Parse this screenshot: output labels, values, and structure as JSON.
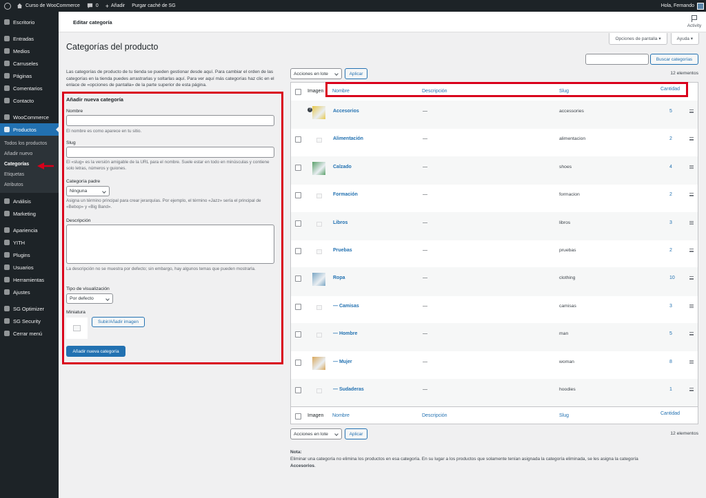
{
  "admin_bar": {
    "site_name": "Curso de WooCommerce",
    "comments_count": "0",
    "new_label": "Añadir",
    "purge_label": "Purgar caché de SG",
    "greeting": "Hola, Fernando"
  },
  "sidebar": {
    "items": [
      {
        "label": "Escritorio",
        "icon": "dashboard-icon"
      },
      {
        "label": "Entradas",
        "icon": "pin-icon"
      },
      {
        "label": "Medios",
        "icon": "media-icon"
      },
      {
        "label": "Carruseles",
        "icon": "carousel-icon"
      },
      {
        "label": "Páginas",
        "icon": "page-icon"
      },
      {
        "label": "Comentarios",
        "icon": "comment-icon"
      },
      {
        "label": "Contacto",
        "icon": "mail-icon"
      },
      {
        "label": "WooCommerce",
        "icon": "woo-icon"
      },
      {
        "label": "Productos",
        "icon": "product-icon"
      }
    ],
    "submenu": [
      "Todos los productos",
      "Añadir nuevo",
      "Categorías",
      "Etiquetas",
      "Atributos"
    ],
    "items_after": [
      {
        "label": "Análisis",
        "icon": "chart-icon"
      },
      {
        "label": "Marketing",
        "icon": "megaphone-icon"
      },
      {
        "label": "Apariencia",
        "icon": "brush-icon"
      },
      {
        "label": "YITH",
        "icon": "yith-icon"
      },
      {
        "label": "Plugins",
        "icon": "plugin-icon"
      },
      {
        "label": "Usuarios",
        "icon": "user-icon"
      },
      {
        "label": "Herramientas",
        "icon": "wrench-icon"
      },
      {
        "label": "Ajustes",
        "icon": "settings-icon"
      },
      {
        "label": "SG Optimizer",
        "icon": "sg-optimizer-icon"
      },
      {
        "label": "SG Security",
        "icon": "shield-icon"
      },
      {
        "label": "Cerrar menú",
        "icon": "collapse-icon"
      }
    ]
  },
  "header": {
    "page_label": "Editar categoría",
    "activity": "Activity",
    "screen_options": "Opciones de pantalla ▾",
    "help": "Ayuda ▾"
  },
  "title": "Categorías del producto",
  "intro": "Las categorías de producto de tu tienda se pueden gestionar desde aquí. Para cambiar el orden de las categorías en la tienda puedes arrastrarlas y soltarlas aquí. Para ver aquí más categorías haz clic en el enlace de «opciones de pantalla» de la parte superior de esta página.",
  "form": {
    "heading": "Añadir nueva categoría",
    "name_label": "Nombre",
    "name_help": "El nombre es como aparece en tu sitio.",
    "slug_label": "Slug",
    "slug_help": "El «slug» es la versión amigable de la URL para el nombre. Suele estar en todo en minúsculas y contiene solo letras, números y guiones.",
    "parent_label": "Categoría padre",
    "parent_value": "Ninguna",
    "parent_help": "Asigna un término principal para crear jerarquías. Por ejemplo, el término «Jazz» sería el principal de «Bebop» y «Big Band».",
    "desc_label": "Descripción",
    "desc_help": "La descripción no se muestra por defecto; sin embargo, hay algunos temas que pueden mostrarla.",
    "display_label": "Tipo de visualización",
    "display_value": "Por defecto",
    "thumb_label": "Miniatura",
    "upload_button": "Subir/Añadir imagen",
    "submit_button": "Añadir nueva categoría"
  },
  "search_button": "Buscar categorías",
  "bulk": {
    "label": "Acciones en lote",
    "apply": "Aplicar"
  },
  "items_count": "12 elementos",
  "columns": {
    "image": "Imagen",
    "name": "Nombre",
    "description": "Descripción",
    "slug": "Slug",
    "count": "Cantidad"
  },
  "rows": [
    {
      "name": "Accesorios",
      "desc": "—",
      "slug": "accessories",
      "count": "5",
      "img": "accessories-thumb",
      "color": "#e8c84a"
    },
    {
      "name": "Alimentación",
      "desc": "—",
      "slug": "alimentacion",
      "count": "2",
      "img": "placeholder"
    },
    {
      "name": "Calzado",
      "desc": "—",
      "slug": "shoes",
      "count": "4",
      "img": "shoes-thumb",
      "color": "#5aa06a"
    },
    {
      "name": "Formación",
      "desc": "—",
      "slug": "formacion",
      "count": "2",
      "img": "placeholder"
    },
    {
      "name": "Libros",
      "desc": "—",
      "slug": "libros",
      "count": "3",
      "img": "placeholder"
    },
    {
      "name": "Pruebas",
      "desc": "—",
      "slug": "pruebas",
      "count": "2",
      "img": "placeholder"
    },
    {
      "name": "Ropa",
      "desc": "—",
      "slug": "clothing",
      "count": "10",
      "img": "clothing-thumb",
      "color": "#7aa6c4"
    },
    {
      "name": "— Camisas",
      "desc": "—",
      "slug": "camisas",
      "count": "3",
      "img": "placeholder"
    },
    {
      "name": "— Hombre",
      "desc": "—",
      "slug": "man",
      "count": "5",
      "img": "placeholder"
    },
    {
      "name": "— Mujer",
      "desc": "—",
      "slug": "woman",
      "count": "8",
      "img": "woman-thumb",
      "color": "#d9a85c"
    },
    {
      "name": "— Sudaderas",
      "desc": "—",
      "slug": "hoodies",
      "count": "1",
      "img": "placeholder"
    }
  ],
  "note_title": "Nota:",
  "note_text": "Eliminar una categoría no elimina los productos en esa categoría. En su lugar a los productos que solamente tenían asignada la categoría eliminada, se les asigna la categoría",
  "note_cat": "Accesorios",
  "colors": {
    "accent": "#2271b1",
    "highlight": "#d9001b",
    "sidebar": "#1d2327"
  }
}
